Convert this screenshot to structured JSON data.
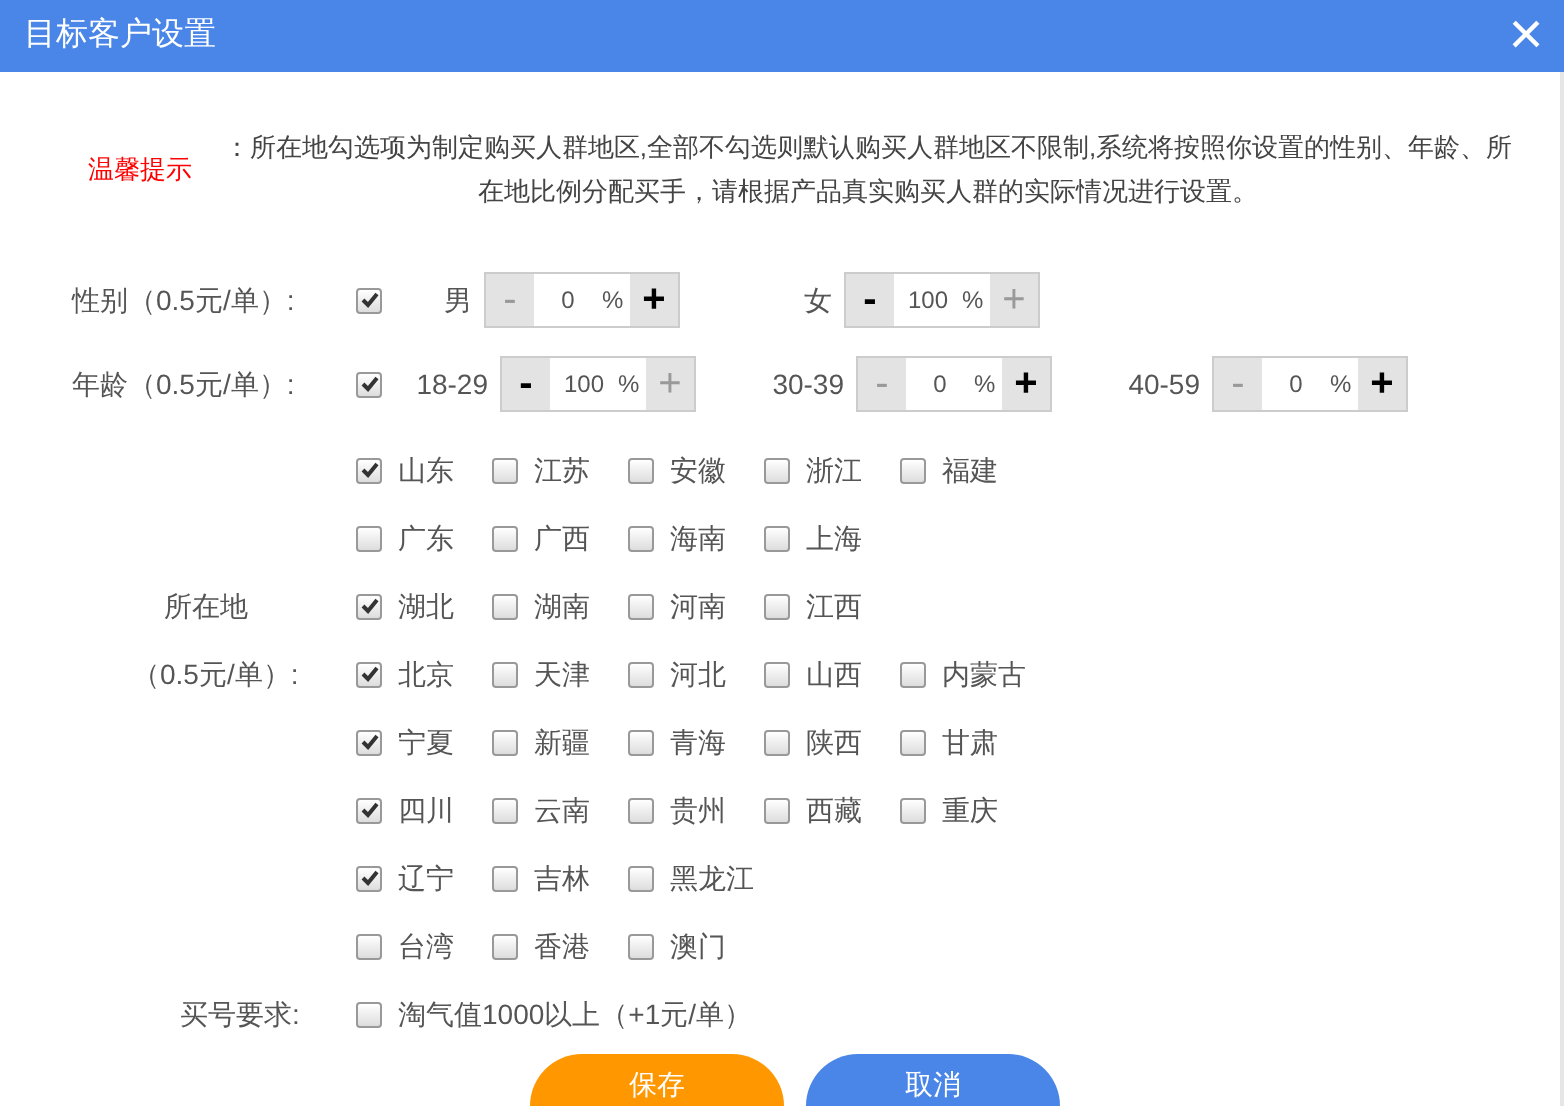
{
  "window": {
    "title": "目标客户设置",
    "close": "×"
  },
  "notice": {
    "label": "温馨提示",
    "text": "：所在地勾选项为制定购买人群地区,全部不勾选则默认购买人群地区不限制,系统将按照你设置的性别、年龄、所在地比例分配买手，请根据产品真实购买人群的实际情况进行设置。"
  },
  "gender": {
    "label": "性别（0.5元/单）:",
    "checked": true,
    "options": [
      {
        "name": "男",
        "value": "0",
        "unit": "%",
        "minus": {
          "text": "-",
          "disabled": true
        },
        "plus": {
          "text": "+",
          "disabled": false
        }
      },
      {
        "name": "女",
        "value": "100",
        "unit": "%",
        "minus": {
          "text": "-",
          "disabled": false
        },
        "plus": {
          "text": "+",
          "disabled": true
        }
      }
    ]
  },
  "age": {
    "label": "年龄（0.5元/单）:",
    "checked": true,
    "options": [
      {
        "name": "18-29",
        "value": "100",
        "unit": "%",
        "minus": {
          "text": "-",
          "disabled": false
        },
        "plus": {
          "text": "+",
          "disabled": true
        }
      },
      {
        "name": "30-39",
        "value": "0",
        "unit": "%",
        "minus": {
          "text": "-",
          "disabled": true
        },
        "plus": {
          "text": "+",
          "disabled": false
        }
      },
      {
        "name": "40-59",
        "value": "0",
        "unit": "%",
        "minus": {
          "text": "-",
          "disabled": true
        },
        "plus": {
          "text": "+",
          "disabled": false
        }
      }
    ]
  },
  "region": {
    "label_lines": [
      "所在地",
      "（0.5元/单）:"
    ],
    "rows": [
      [
        {
          "name": "山东",
          "checked": true
        },
        {
          "name": "江苏",
          "checked": false
        },
        {
          "name": "安徽",
          "checked": false
        },
        {
          "name": "浙江",
          "checked": false
        },
        {
          "name": "福建",
          "checked": false
        }
      ],
      [
        {
          "name": "广东",
          "checked": false
        },
        {
          "name": "广西",
          "checked": false
        },
        {
          "name": "海南",
          "checked": false
        },
        {
          "name": "上海",
          "checked": false
        }
      ],
      [
        {
          "name": "湖北",
          "checked": true
        },
        {
          "name": "湖南",
          "checked": false
        },
        {
          "name": "河南",
          "checked": false
        },
        {
          "name": "江西",
          "checked": false
        }
      ],
      [
        {
          "name": "北京",
          "checked": true
        },
        {
          "name": "天津",
          "checked": false
        },
        {
          "name": "河北",
          "checked": false
        },
        {
          "name": "山西",
          "checked": false
        },
        {
          "name": "内蒙古",
          "checked": false
        }
      ],
      [
        {
          "name": "宁夏",
          "checked": true
        },
        {
          "name": "新疆",
          "checked": false
        },
        {
          "name": "青海",
          "checked": false
        },
        {
          "name": "陕西",
          "checked": false
        },
        {
          "name": "甘肃",
          "checked": false
        }
      ],
      [
        {
          "name": "四川",
          "checked": true
        },
        {
          "name": "云南",
          "checked": false
        },
        {
          "name": "贵州",
          "checked": false
        },
        {
          "name": "西藏",
          "checked": false
        },
        {
          "name": "重庆",
          "checked": false
        }
      ],
      [
        {
          "name": "辽宁",
          "checked": true
        },
        {
          "name": "吉林",
          "checked": false
        },
        {
          "name": "黑龙江",
          "checked": false
        }
      ],
      [
        {
          "name": "台湾",
          "checked": false
        },
        {
          "name": "香港",
          "checked": false
        },
        {
          "name": "澳门",
          "checked": false
        }
      ]
    ]
  },
  "account": {
    "label": "买号要求:",
    "option": {
      "name": "淘气值1000以上（+1元/单）",
      "checked": false
    }
  },
  "buttons": [
    {
      "label": "保存",
      "kind": "primary"
    },
    {
      "label": "取消",
      "kind": "secondary"
    }
  ]
}
